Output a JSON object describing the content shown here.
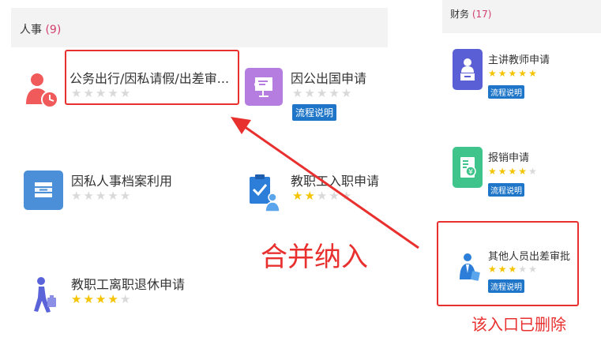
{
  "left_panel": {
    "header": {
      "title": "人事",
      "count": "(9)"
    },
    "items": [
      {
        "name": "公务出行/因私请假/出差审...",
        "rating": 0,
        "icon": "person-clock-icon"
      },
      {
        "name": "因公出国申请",
        "rating": 0,
        "badge": "流程说明",
        "icon": "presentation-board-icon",
        "icon_color": "#b67de0"
      },
      {
        "name": "因私人事档案利用",
        "rating": 0,
        "icon": "archive-stack-icon",
        "icon_color": "#4a8fd8"
      },
      {
        "name": "教职工入职申请",
        "rating": 2,
        "icon": "clipboard-person-icon"
      },
      {
        "name": "教职工离职退休申请",
        "rating": 4,
        "icon": "walking-person-icon"
      }
    ]
  },
  "right_panel": {
    "header": {
      "title": "财务",
      "count": "(17)"
    },
    "items": [
      {
        "name": "主讲教师申请",
        "rating": 5,
        "badge": "流程说明",
        "icon": "teacher-podium-icon",
        "icon_color": "#5a5fd6"
      },
      {
        "name": "报销申请",
        "rating": 4,
        "badge": "流程说明",
        "icon": "receipt-yen-icon",
        "icon_color": "#3fc58b"
      },
      {
        "name": "其他人员出差审批",
        "rating": 3,
        "badge": "流程说明",
        "icon": "business-person-icon"
      }
    ]
  },
  "annotations": {
    "merge": "合并纳入",
    "deleted": "该入口已删除"
  },
  "colors": {
    "accent": "#e8302f",
    "badge": "#1f76c9",
    "star_on": "#f5c400",
    "star_off": "#d9d9d9",
    "count": "#d23f6f"
  }
}
